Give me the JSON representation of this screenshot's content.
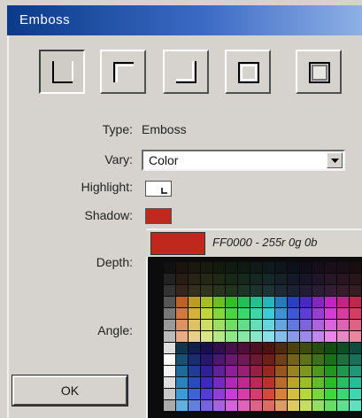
{
  "window": {
    "title": "Emboss"
  },
  "styles": [
    {
      "name": "style-inset"
    },
    {
      "name": "style-raised"
    },
    {
      "name": "style-corner"
    },
    {
      "name": "style-frame"
    },
    {
      "name": "style-bevel"
    }
  ],
  "fields": {
    "type_label": "Type:",
    "type_value": "Emboss",
    "vary_label": "Vary:",
    "vary_value": "Color",
    "highlight_label": "Highlight:",
    "shadow_label": "Shadow:",
    "depth_label": "Depth:",
    "angle_label": "Angle:"
  },
  "colors": {
    "highlight": "#ffffff",
    "shadow": "#c0281e",
    "titlebar": "#0a3a88"
  },
  "picker": {
    "current_color": "#c0281e",
    "code": "FF0000 - 255r 0g 0b"
  },
  "buttons": {
    "ok": "OK"
  }
}
